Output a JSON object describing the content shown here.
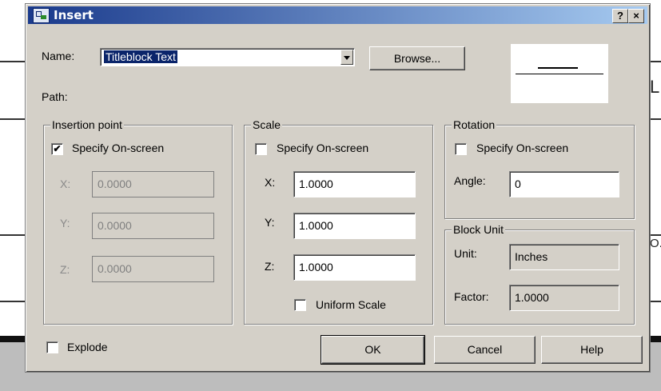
{
  "dialog": {
    "title": "Insert",
    "help_glyph": "?",
    "close_glyph": "×"
  },
  "name": {
    "label": "Name:",
    "value": "Titleblock Text",
    "browse_label": "Browse..."
  },
  "path": {
    "label": "Path:"
  },
  "insertion_point": {
    "title": "Insertion point",
    "specify_label": "Specify On-screen",
    "specify_checked": true,
    "x_label": "X:",
    "x_value": "0.0000",
    "y_label": "Y:",
    "y_value": "0.0000",
    "z_label": "Z:",
    "z_value": "0.0000"
  },
  "scale": {
    "title": "Scale",
    "specify_label": "Specify On-screen",
    "specify_checked": false,
    "x_label": "X:",
    "x_value": "1.0000",
    "y_label": "Y:",
    "y_value": "1.0000",
    "z_label": "Z:",
    "z_value": "1.0000",
    "uniform_label": "Uniform Scale",
    "uniform_checked": false
  },
  "rotation": {
    "title": "Rotation",
    "specify_label": "Specify On-screen",
    "specify_checked": false,
    "angle_label": "Angle:",
    "angle_value": "0"
  },
  "block_unit": {
    "title": "Block Unit",
    "unit_label": "Unit:",
    "unit_value": "Inches",
    "factor_label": "Factor:",
    "factor_value": "1.0000"
  },
  "explode": {
    "label": "Explode",
    "checked": false
  },
  "buttons": {
    "ok": "OK",
    "cancel": "Cancel",
    "help": "Help"
  },
  "background": {
    "right_letter": "L",
    "right_letter2": "O."
  }
}
